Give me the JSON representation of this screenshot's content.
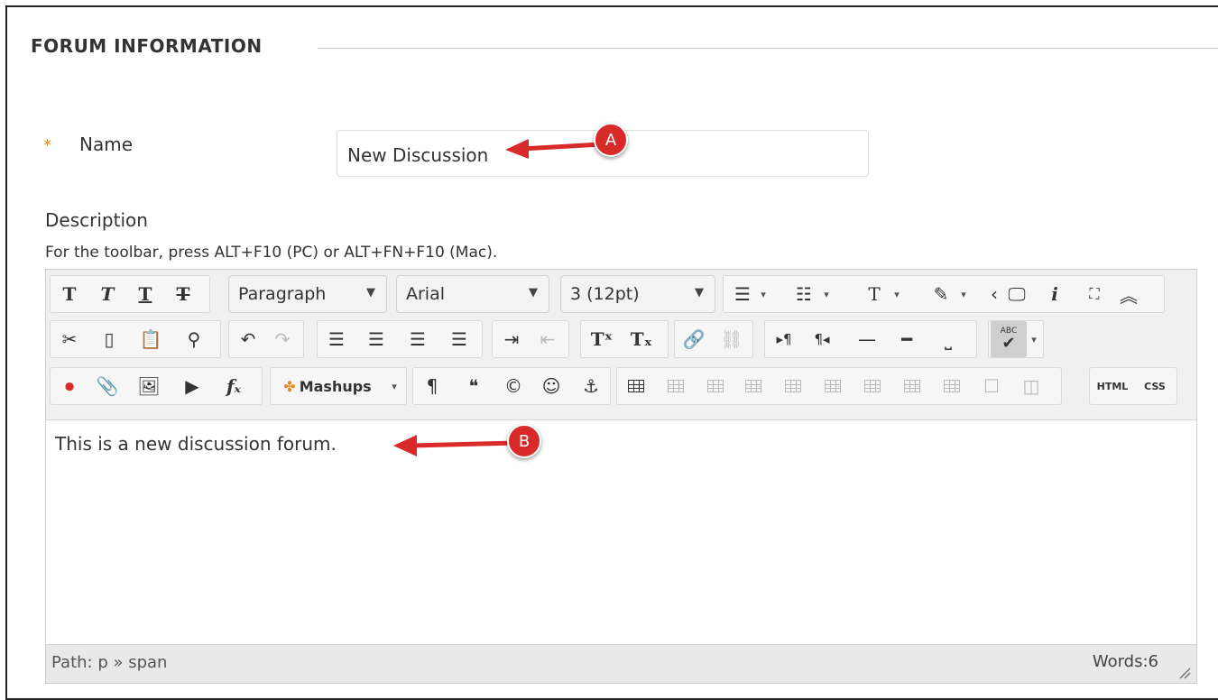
{
  "section": {
    "title": "FORUM INFORMATION"
  },
  "name_field": {
    "required_mark": "*",
    "label": "Name",
    "value": "New Discussion"
  },
  "description": {
    "label": "Description",
    "toolbar_hint": "For the toolbar, press ALT+F10 (PC) or ALT+FN+F10 (Mac)."
  },
  "toolbar": {
    "format_select": "Paragraph",
    "font_select": "Arial",
    "size_select": "3 (12pt)",
    "mashups_label": "Mashups",
    "html_label": "HTML",
    "css_label": "CSS",
    "spell_label": "ABC"
  },
  "editor": {
    "content": "This is a new discussion forum."
  },
  "status": {
    "path": "Path: p » span",
    "words": "Words:6"
  },
  "callouts": {
    "a": "A",
    "b": "B"
  },
  "colors": {
    "callout": "#d92a2a",
    "required": "#e6892d"
  }
}
